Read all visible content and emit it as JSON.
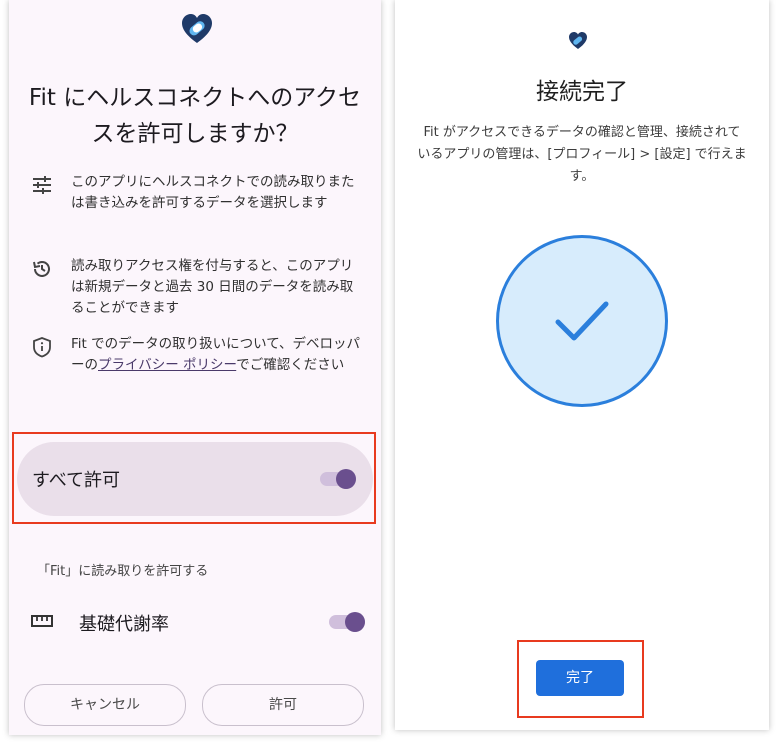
{
  "left": {
    "title": "Fit にヘルスコネクトへのアクセスを許可しますか？",
    "info": [
      {
        "icon": "tune-sliders-icon",
        "text": "このアプリにヘルスコネクトでの読み取りまたは書き込みを許可するデータを選択します"
      },
      {
        "icon": "history-icon",
        "text": "読み取りアクセス権を付与すると、このアプリは新規データと過去 30 日間のデータを読み取ることができます"
      },
      {
        "icon": "shield-info-icon",
        "text_before": "Fit でのデータの取り扱いについて、デベロッパーの",
        "link": "プライバシー ポリシー",
        "text_after": "でご確認ください"
      }
    ],
    "allow_all_label": "すべて許可",
    "allow_all_on": true,
    "read_section": "「Fit」に読み取りを許可する",
    "permission": {
      "icon": "ruler-icon",
      "label": "基礎代謝率",
      "on": true
    },
    "cancel": "キャンセル",
    "allow": "許可"
  },
  "right": {
    "title": "接続完了",
    "description": "Fit がアクセスできるデータの確認と管理、接続されているアプリの管理は、[プロフィール] > [設定] で行えます。",
    "done_button": "完了"
  },
  "colors": {
    "highlight": "#e83a1f",
    "toggle_thumb": "#6a4f8e",
    "primary_blue": "#1f6fdc",
    "check_circle_fill": "#d7ecfc"
  }
}
